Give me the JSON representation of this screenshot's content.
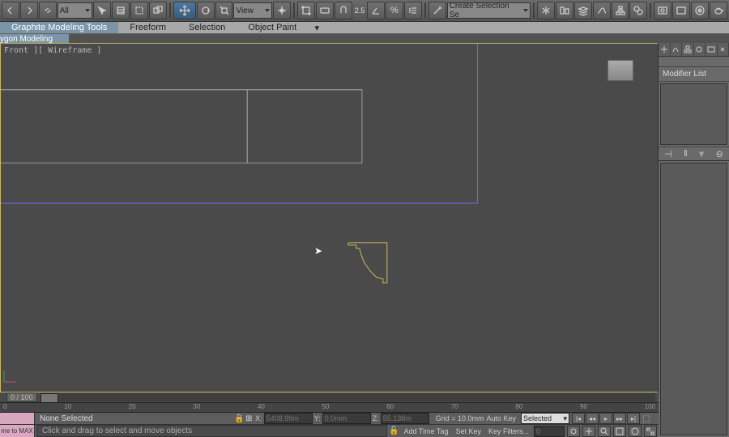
{
  "toolbar": {
    "filter_dropdown": "All",
    "view_dropdown": "View",
    "coord_readout": "2.5",
    "named_sel": "Create Selection Se"
  },
  "ribbon": {
    "tabs": [
      "Graphite Modeling Tools",
      "Freeform",
      "Selection",
      "Object Paint"
    ],
    "subtab": "ygon Modeling"
  },
  "viewport": {
    "label": "Front ][ Wireframe ]"
  },
  "cmdpanel": {
    "modlist_label": "Modifier List"
  },
  "track": {
    "frame": "0 / 100",
    "ticks": [
      "0",
      "10",
      "20",
      "30",
      "40",
      "50",
      "60",
      "70",
      "80",
      "90",
      "100"
    ]
  },
  "status": {
    "selection": "None Selected",
    "x": "5408.99m",
    "y": "0.0mm",
    "z": "55.138m",
    "grid": "Grid = 10.0mm",
    "autokey": "Auto Key",
    "autokey_mode": "Selected",
    "setkey": "Set Key",
    "keyfilters": "Key Filters...",
    "welcome": "me to MAX",
    "prompt": "Click and drag to select and move objects",
    "addtag": "Add Time Tag"
  }
}
